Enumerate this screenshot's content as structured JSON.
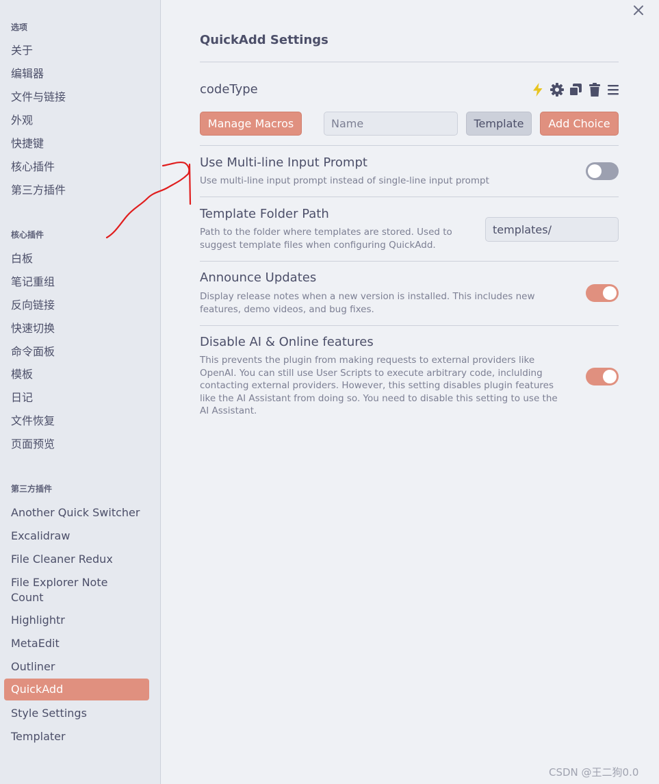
{
  "sidebar": {
    "sections": [
      {
        "heading": "选项",
        "items": [
          "关于",
          "编辑器",
          "文件与链接",
          "外观",
          "快捷键",
          "核心插件",
          "第三方插件"
        ]
      },
      {
        "heading": "核心插件",
        "items": [
          "白板",
          "笔记重组",
          "反向链接",
          "快速切换",
          "命令面板",
          "模板",
          "日记",
          "文件恢复",
          "页面预览"
        ]
      },
      {
        "heading": "第三方插件",
        "items": [
          "Another Quick Switcher",
          "Excalidraw",
          "File Cleaner Redux",
          "File Explorer Note Count",
          "Highlightr",
          "MetaEdit",
          "Outliner",
          "QuickAdd",
          "Style Settings",
          "Templater"
        ],
        "active": "QuickAdd"
      }
    ]
  },
  "close_icon": "close-icon",
  "main": {
    "title": "QuickAdd Settings",
    "choice": {
      "name": "codeType",
      "icons": [
        "lightning-icon",
        "gear-icon",
        "duplicate-icon",
        "trash-icon",
        "menu-icon"
      ]
    },
    "toolbar": {
      "manage_macros_label": "Manage Macros",
      "name_placeholder": "Name",
      "template_label": "Template",
      "add_choice_label": "Add Choice"
    },
    "settings": [
      {
        "title": "Use Multi-line Input Prompt",
        "desc": [
          "Use multi-line input prompt instead of single-line input prompt"
        ],
        "control": "toggle",
        "enabled": false
      },
      {
        "title": "Template Folder Path",
        "desc": [
          "Path to the folder where templates are stored. Used to",
          "suggest template files when configuring QuickAdd."
        ],
        "control": "text",
        "value": "templates/"
      },
      {
        "title": "Announce Updates",
        "desc": [
          "Display release notes when a new version is installed. This includes new",
          "features, demo videos, and bug fixes."
        ],
        "control": "toggle",
        "enabled": true
      },
      {
        "title": "Disable AI & Online features",
        "desc": [
          "This prevents the plugin from making requests to external providers like",
          "OpenAI. You can still use User Scripts to execute arbitrary code, inclulding",
          "contacting external providers. However, this setting disables plugin features",
          "like the AI Assistant from doing so. You need to disable this setting to use the",
          "AI Assistant."
        ],
        "control": "toggle",
        "enabled": true
      }
    ]
  },
  "colors": {
    "accent": "#e0907f",
    "background": "#eff1f5",
    "sidebar": "#e6e9ef",
    "annotation": "#e01e1e"
  },
  "watermark": "CSDN @王二狗0.0"
}
